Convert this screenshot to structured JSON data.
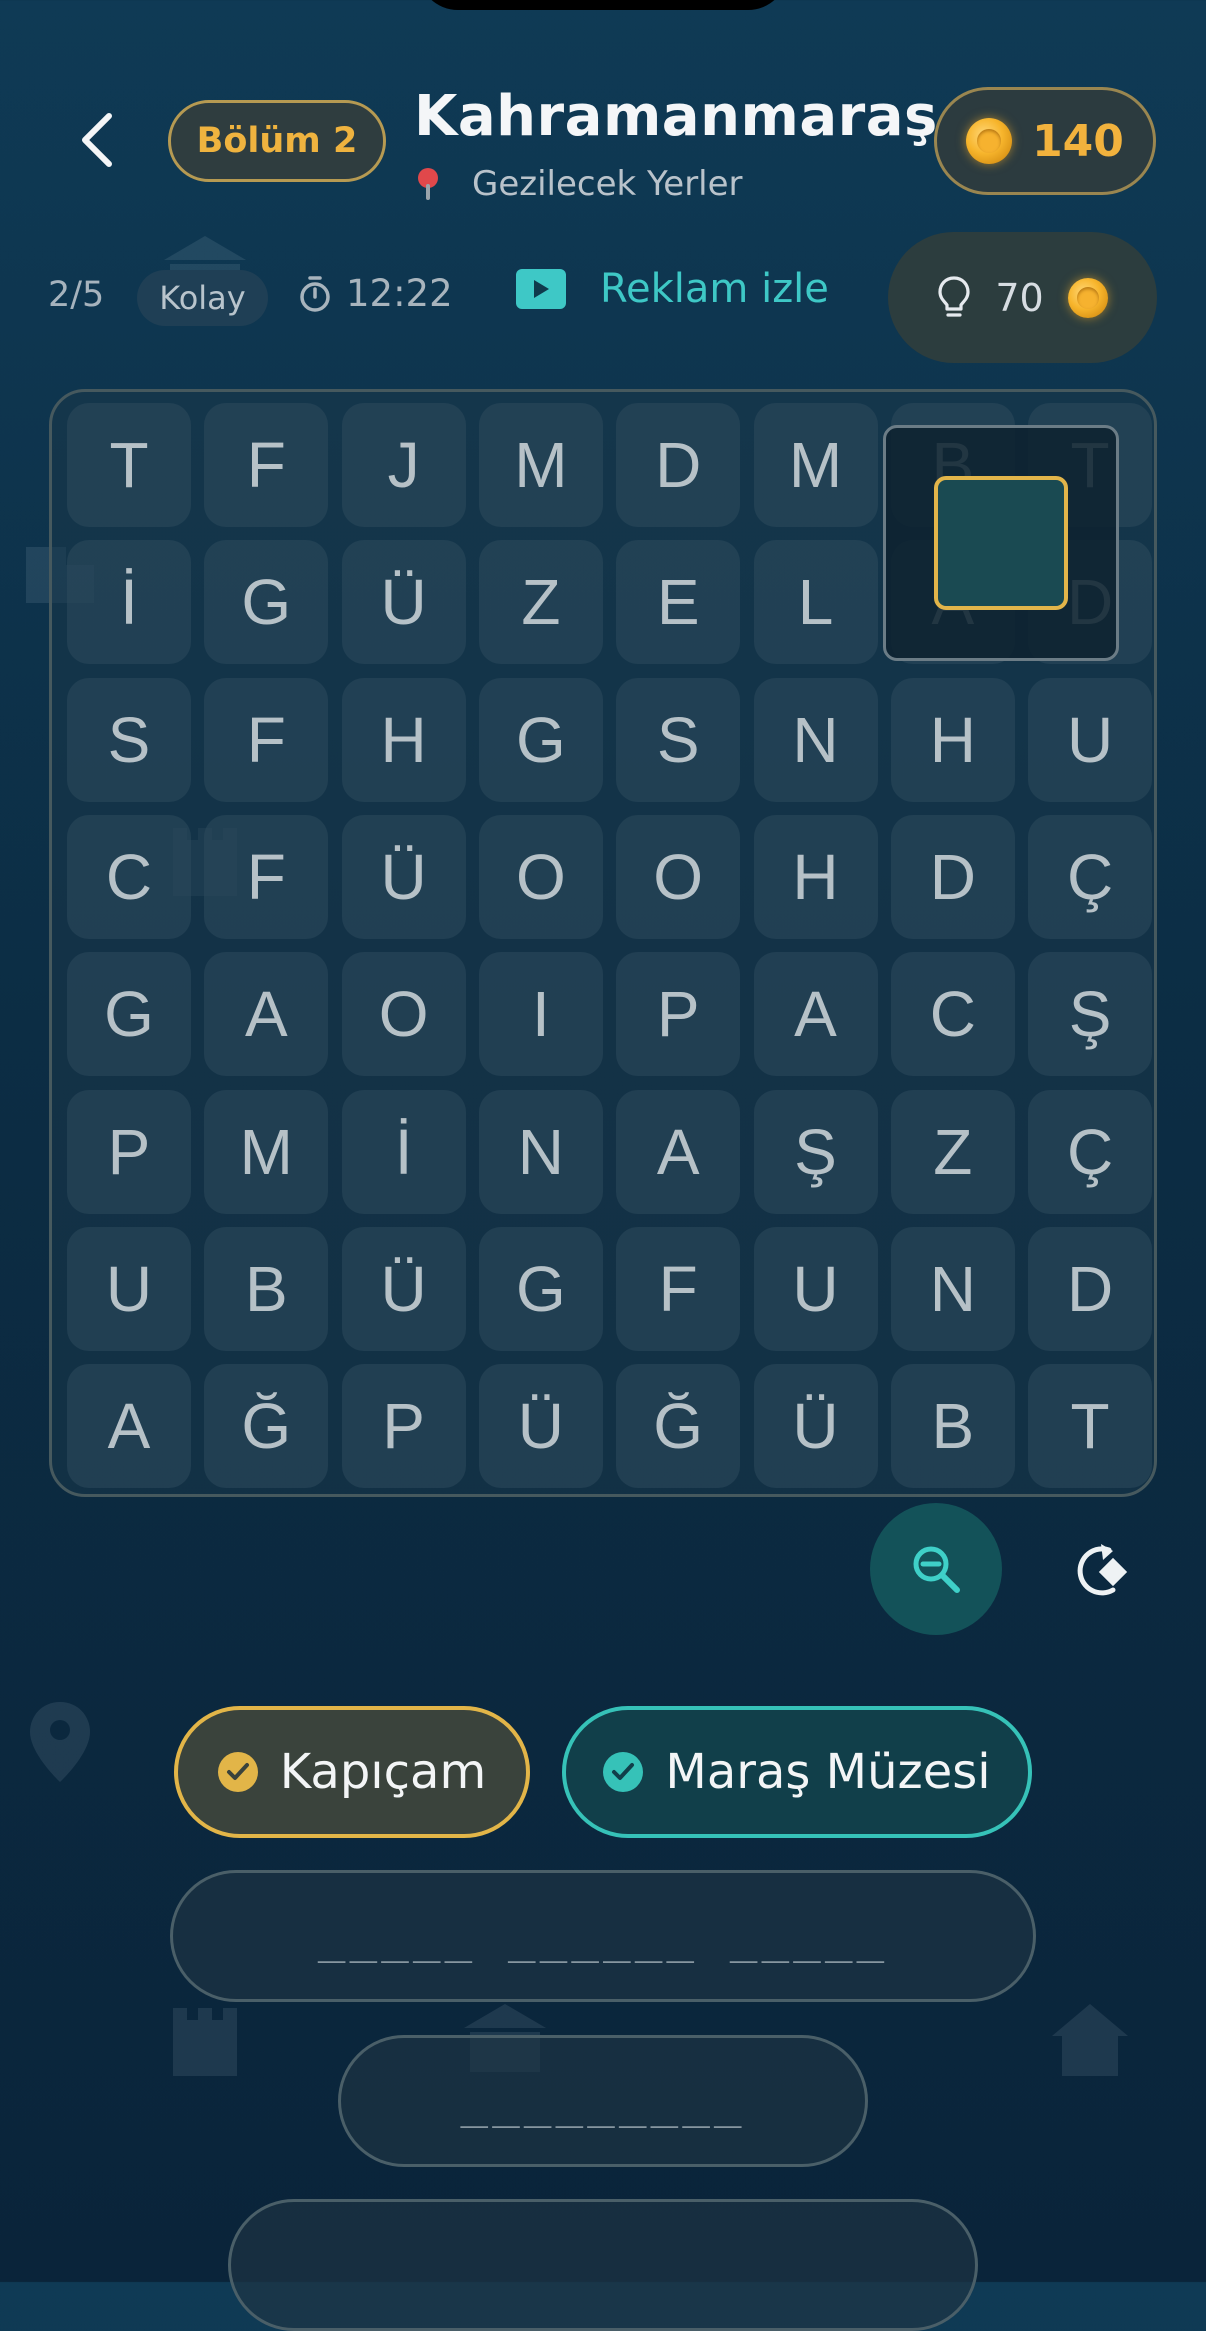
{
  "header": {
    "level_label": "Bölüm 2",
    "title": "Kahramanmaraş",
    "subtitle": "Gezilecek Yerler",
    "coins": "140"
  },
  "stats": {
    "progress": "2/5",
    "difficulty": "Kolay",
    "timer": "12:22",
    "ad_label": "Reklam izle",
    "hint_cost": "70"
  },
  "grid": [
    [
      "T",
      "F",
      "J",
      "M",
      "D",
      "M",
      "B",
      "T"
    ],
    [
      "İ",
      "G",
      "Ü",
      "Z",
      "E",
      "L",
      "A",
      "D"
    ],
    [
      "S",
      "F",
      "H",
      "G",
      "S",
      "N",
      "H",
      "U"
    ],
    [
      "C",
      "F",
      "Ü",
      "O",
      "O",
      "H",
      "D",
      "Ç"
    ],
    [
      "G",
      "A",
      "O",
      "I",
      "P",
      "A",
      "C",
      "Ş"
    ],
    [
      "P",
      "M",
      "İ",
      "N",
      "A",
      "Ş",
      "Z",
      "Ç"
    ],
    [
      "U",
      "B",
      "Ü",
      "G",
      "F",
      "U",
      "N",
      "D"
    ],
    [
      "A",
      "Ğ",
      "P",
      "Ü",
      "Ğ",
      "Ü",
      "B",
      "T"
    ]
  ],
  "found_words": [
    "Kapıçam",
    "Maraş Müzesi"
  ],
  "word_slots": [
    "_____ ______ _____",
    "_________",
    ""
  ],
  "colors": {
    "accent_gold": "#e2b548",
    "accent_teal": "#36c2b8",
    "background": "#0c2d44"
  },
  "icons": [
    "back-arrow-icon",
    "location-pin-icon",
    "coin-icon",
    "stopwatch-icon",
    "play-icon",
    "lightbulb-icon",
    "zoom-out-icon",
    "rotate-icon",
    "check-icon"
  ]
}
